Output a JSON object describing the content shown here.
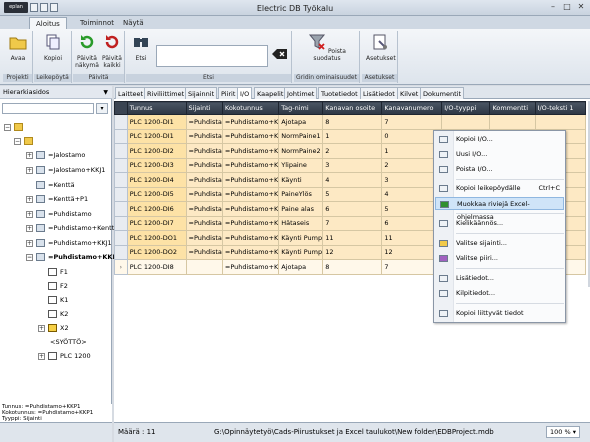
{
  "app": {
    "logo_text": "eplan",
    "title": "Electric DB Työkalu"
  },
  "ribbon_tabs": [
    "Aloitus",
    "Toiminnot",
    "Näytä"
  ],
  "ribbon": {
    "groups": [
      {
        "label": "Projekti",
        "buttons": [
          "Avaa"
        ]
      },
      {
        "label": "Leikepöytä",
        "buttons": [
          "Kopioi"
        ]
      },
      {
        "label": "Päivitä",
        "buttons": [
          "Päivitä näkymä",
          "Päivitä kaikki"
        ]
      },
      {
        "label": "Etsi",
        "buttons": [
          "Etsi"
        ]
      },
      {
        "label": "Gridin ominaisuudet",
        "buttons": [
          "Poista suodatus"
        ]
      },
      {
        "label": "Asetukset",
        "buttons": [
          "Asetukset"
        ]
      }
    ]
  },
  "left_panel": {
    "header": "Hierarkiasidos",
    "tree": [
      {
        "label": ""
      },
      {
        "label": ""
      },
      {
        "label": "=Jalostamo"
      },
      {
        "label": "=Jalostamo+KKJ1"
      },
      {
        "label": "=Kenttä"
      },
      {
        "label": "=Kenttä+P1"
      },
      {
        "label": "=Puhdistamo"
      },
      {
        "label": "=Puhdistamo+Kentt"
      },
      {
        "label": "=Puhdistamo+KKJ1"
      },
      {
        "label": "=Puhdistamo+KKP"
      },
      {
        "label": "F1"
      },
      {
        "label": "F2"
      },
      {
        "label": "K1"
      },
      {
        "label": "K2"
      },
      {
        "label": "X2"
      },
      {
        "label": "<SYÖTTÖ>"
      },
      {
        "label": "PLC 1200"
      }
    ],
    "info": {
      "tunnus": "Tunnus: =Puhdistamo+KKP1",
      "kokotunnus": "Kokotunnus: =Puhdistamo+KKP1",
      "tyyppi": "Tyyppi: Sijainti"
    }
  },
  "main_tabs": [
    "Laitteet",
    "Riviliittimet",
    "Sijainnit",
    "Piirit",
    "I/O",
    "Kaapelit",
    "Johtimet",
    "Tuotetiedot",
    "Lisätiedot",
    "Kilvet",
    "Dokumentit"
  ],
  "grid": {
    "columns": [
      "Tunnus",
      "Sijainti",
      "Kokotunnus",
      "Tag-nimi",
      "Kanavan osoite",
      "Kanavanumero",
      "I/O-tyyppi",
      "Kommentti",
      "I/O-teksti 1"
    ],
    "rows": [
      [
        "PLC 1200-DI1",
        "=Puhdista",
        "=Puhdistamo+K",
        "Ajotapa",
        "8",
        "7",
        "",
        "",
        ""
      ],
      [
        "PLC 1200-DI1",
        "=Puhdista",
        "=Puhdistamo+K",
        "NormPaine1",
        "1",
        "0",
        "",
        "",
        ""
      ],
      [
        "PLC 1200-DI2",
        "=Puhdista",
        "=Puhdistamo+K",
        "NormPaine2",
        "2",
        "1",
        "",
        "",
        ""
      ],
      [
        "PLC 1200-DI3",
        "=Puhdista",
        "=Puhdistamo+K",
        "Ylipaine",
        "3",
        "2",
        "",
        "",
        ""
      ],
      [
        "PLC 1200-DI4",
        "=Puhdista",
        "=Puhdistamo+K",
        "Käynti",
        "4",
        "3",
        "",
        "",
        ""
      ],
      [
        "PLC 1200-DI5",
        "=Puhdista",
        "=Puhdistamo+K",
        "PaineYlös",
        "5",
        "4",
        "",
        "",
        ""
      ],
      [
        "PLC 1200-DI6",
        "=Puhdista",
        "=Puhdistamo+K",
        "Paine alas",
        "6",
        "5",
        "",
        "",
        ""
      ],
      [
        "PLC 1200-DI7",
        "=Puhdista",
        "=Puhdistamo+K",
        "Hätaseis",
        "7",
        "6",
        "",
        "",
        ""
      ],
      [
        "PLC 1200-DO1",
        "=Puhdista",
        "=Puhdistamo+K",
        "Käynti Pump",
        "11",
        "11",
        "",
        "",
        ""
      ],
      [
        "PLC 1200-DO2",
        "=Puhdista",
        "=Puhdistamo+K",
        "Käynti Pump",
        "12",
        "12",
        "",
        "",
        ""
      ],
      [
        "PLC 1200-DI8",
        "",
        "=Puhdistamo+K",
        "Ajotapa",
        "8",
        "7",
        "",
        "",
        ""
      ]
    ]
  },
  "context_menu": [
    {
      "label": "Kopioi I/O...",
      "shortcut": ""
    },
    {
      "label": "Uusi I/O...",
      "shortcut": ""
    },
    {
      "label": "Poista I/O...",
      "shortcut": ""
    },
    {
      "label": "Kopioi leikepöydälle",
      "shortcut": "Ctrl+C"
    },
    {
      "label": "Muokkaa riviejä Excel-ohjelmassa",
      "shortcut": ""
    },
    {
      "label": "Kielikäännös...",
      "shortcut": ""
    },
    {
      "label": "Valitse sijainti...",
      "shortcut": ""
    },
    {
      "label": "Valitse piiri...",
      "shortcut": ""
    },
    {
      "label": "Lisätiedot...",
      "shortcut": ""
    },
    {
      "label": "Kilpitiedot...",
      "shortcut": ""
    },
    {
      "label": "Kopioi liittyvät tiedot",
      "shortcut": ""
    }
  ],
  "status": {
    "count": "Määrä : 11",
    "path": "G:\\Opinnäytetyö\\Cads-Piirustukset ja Excel taulukot\\New folder\\EDBProject.mdb",
    "zoom": "100 %"
  }
}
